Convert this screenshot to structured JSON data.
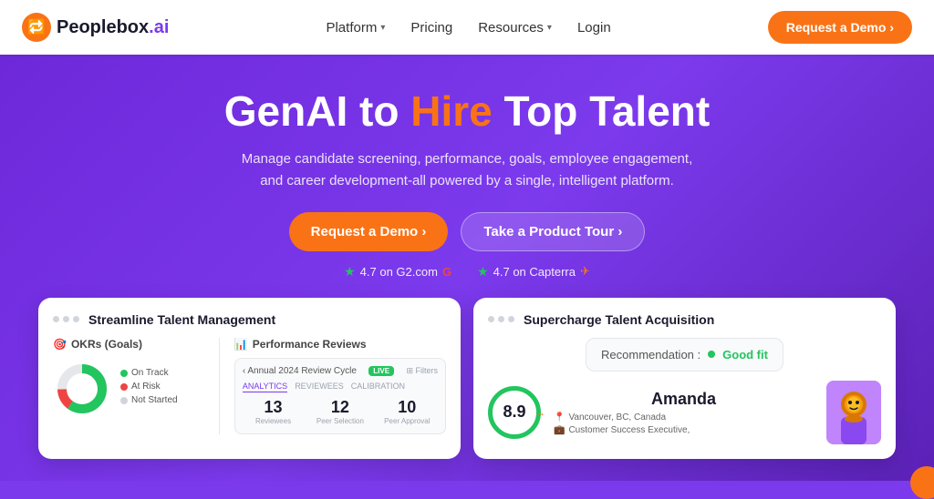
{
  "navbar": {
    "logo_text": "Peoplebox.ai",
    "logo_icon": "🔁",
    "nav_items": [
      {
        "label": "Platform",
        "has_chevron": true
      },
      {
        "label": "Pricing",
        "has_chevron": false
      },
      {
        "label": "Resources",
        "has_chevron": true
      },
      {
        "label": "Login",
        "has_chevron": false
      }
    ],
    "cta_label": "Request a Demo ›"
  },
  "hero": {
    "title_part1": "GenAI to ",
    "title_highlight": "Hire",
    "title_part2": " Top Talent",
    "subtitle": "Manage candidate screening, performance, goals, employee engagement, and career development-all powered by a single, intelligent platform.",
    "btn_demo": "Request a Demo ›",
    "btn_tour": "Take a Product Tour ›",
    "rating1_score": "4.7 on G2.com",
    "rating2_score": "4.7 on Capterra"
  },
  "cards": {
    "left_card": {
      "title": "Streamline Talent Management",
      "okr_title": "OKRs (Goals)",
      "legend": [
        {
          "label": "On Track",
          "color": "#22c55e"
        },
        {
          "label": "At Risk",
          "color": "#ef4444"
        },
        {
          "label": "Not Started",
          "color": "#d1d5db"
        }
      ],
      "perf_title": "Performance Reviews",
      "review_cycle": "Annual 2024 Review Cycle",
      "live_badge": "LIVE",
      "tabs": [
        "ANALYTICS",
        "REVIEWEES",
        "CALIBRATION"
      ],
      "stats": [
        {
          "num": "13",
          "label": "Reviewees"
        },
        {
          "num": "12",
          "label": "Peer Selection"
        },
        {
          "num": "10",
          "label": "Peer Approval"
        }
      ]
    },
    "right_card": {
      "title": "Supercharge Talent Acquisition",
      "recommendation_label": "Recommendation :",
      "good_fit": "Good fit",
      "score": "8.9",
      "candidate_name": "Amanda",
      "location": "Vancouver, BC, Canada",
      "role": "Customer Success Executive,"
    }
  }
}
